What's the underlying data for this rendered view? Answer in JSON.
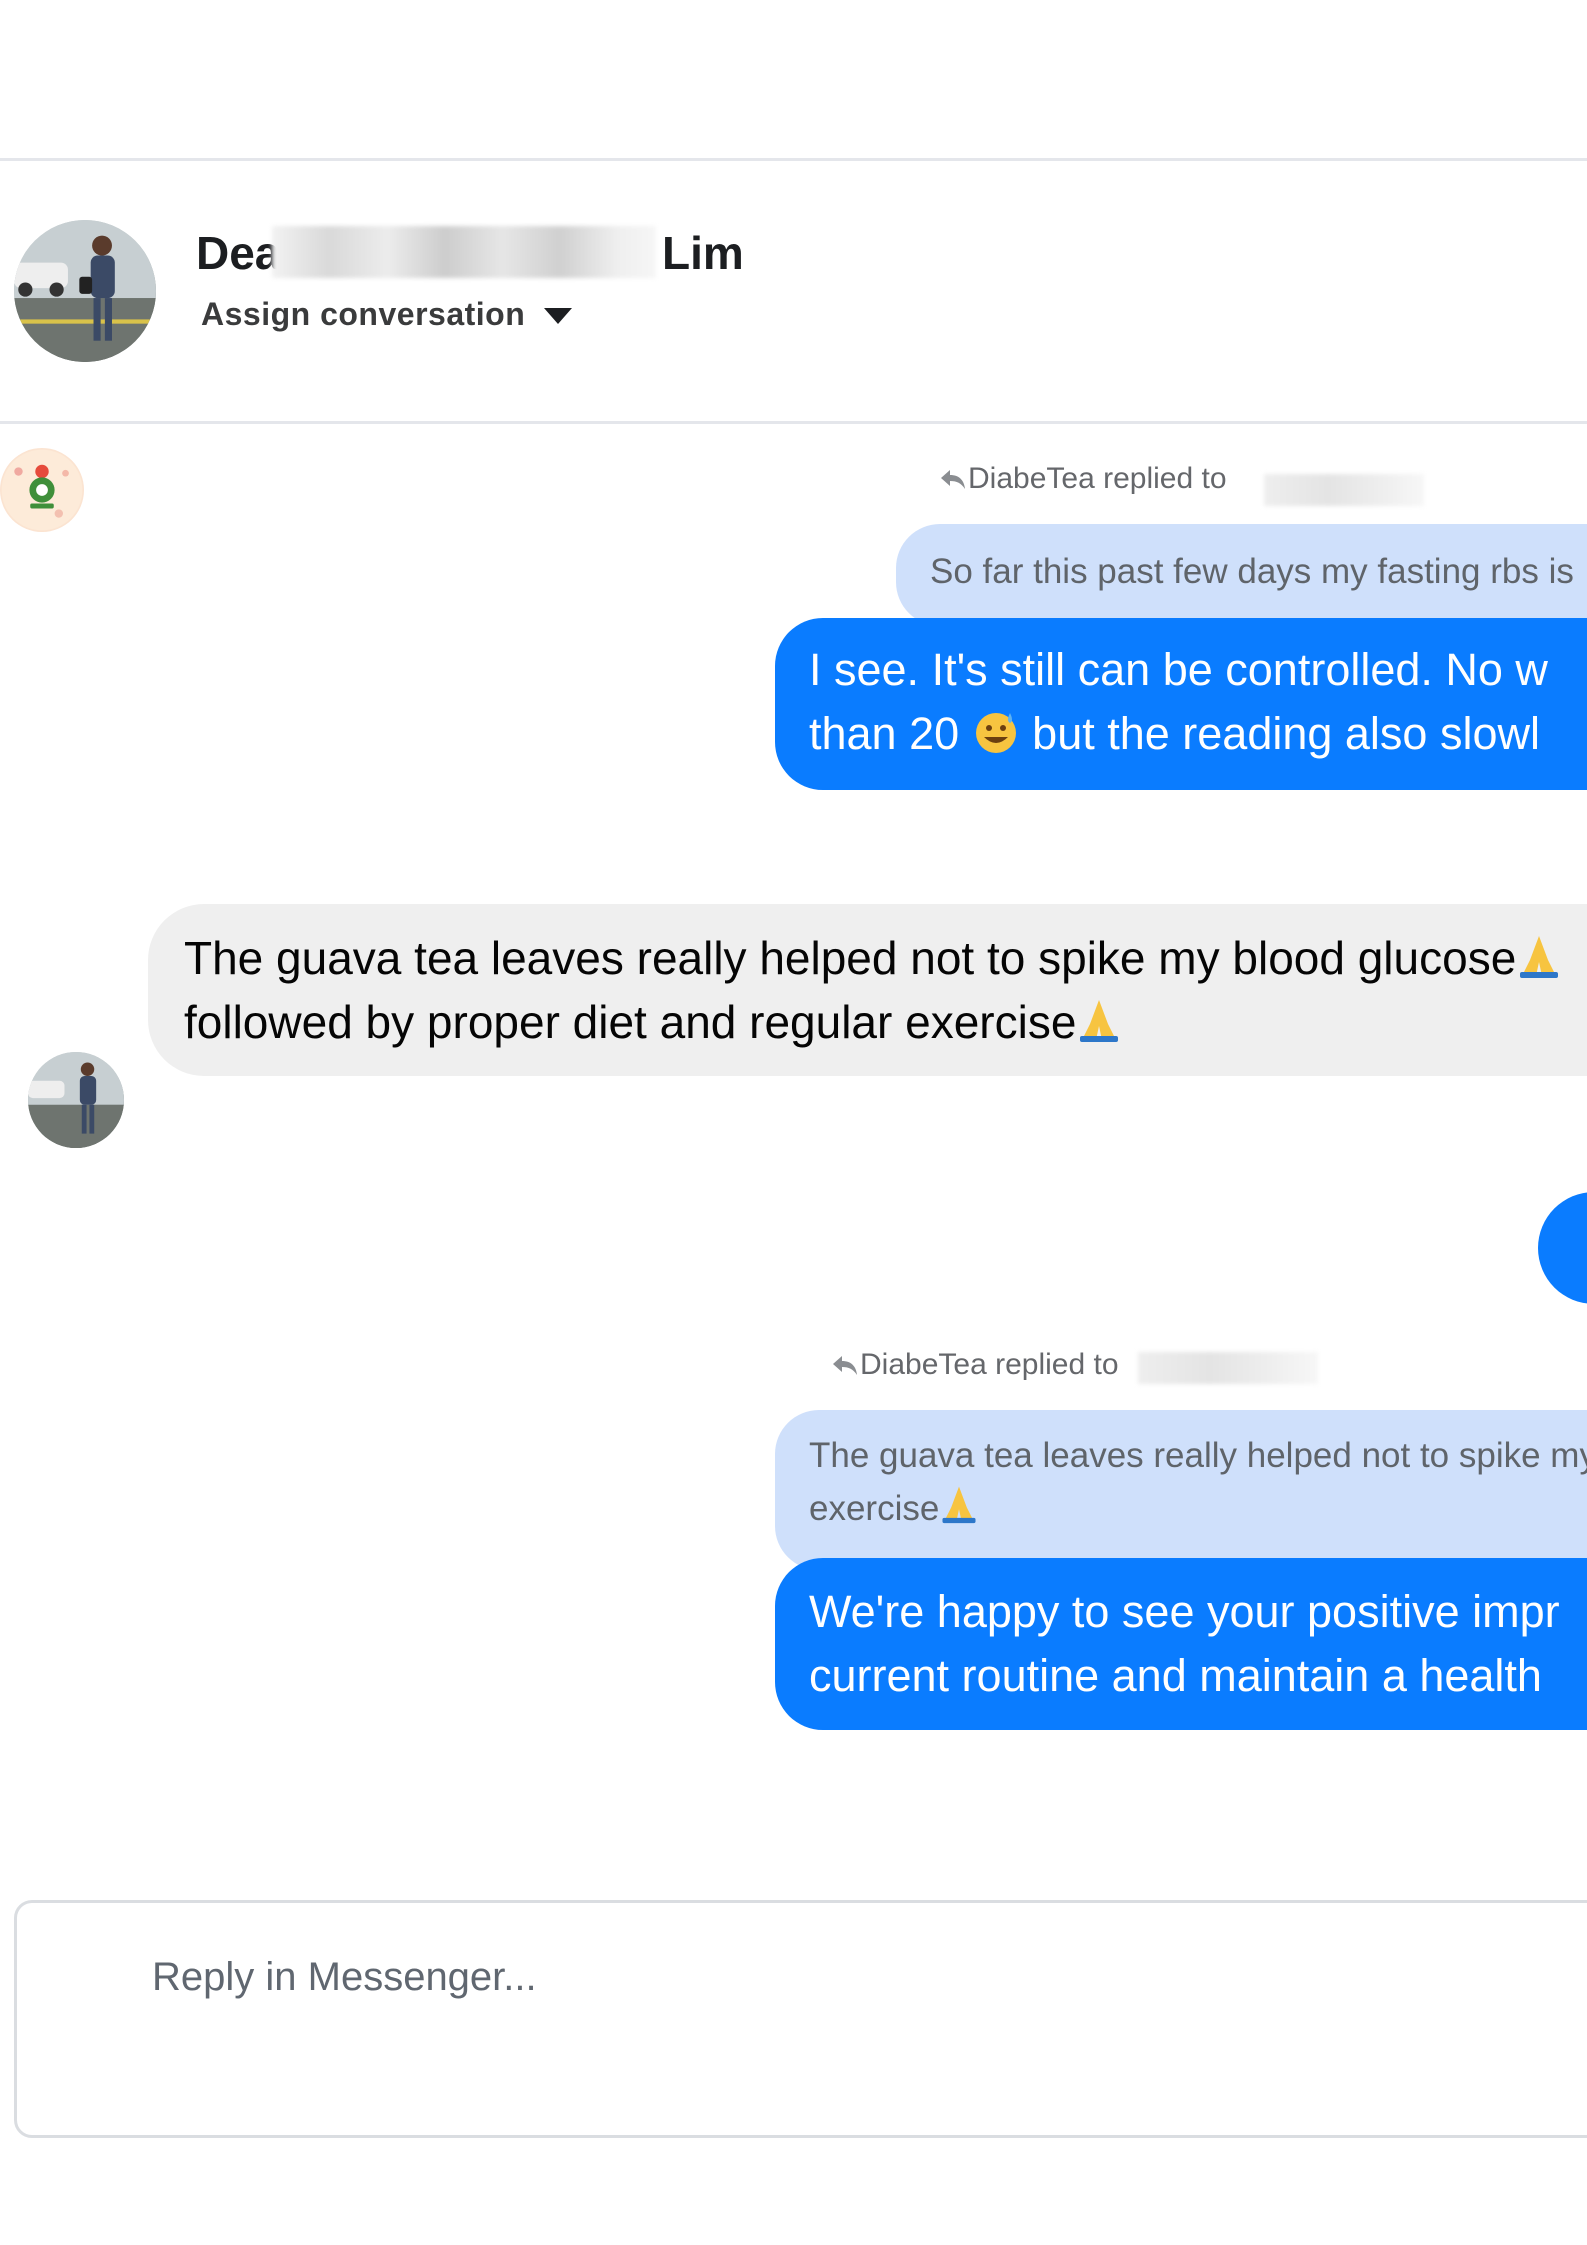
{
  "header": {
    "contact_name_start": "Dea",
    "contact_name_end": "Lim",
    "assign_label": "Assign conversation"
  },
  "messages": {
    "reply1": {
      "replied_label": "DiabeTea replied to",
      "quote": "So far this past few days my fasting rbs is",
      "text_line1": "I see. It's still can be controlled. No w",
      "text_line2_a": "than 20",
      "text_line2_b": "but the reading also slowl"
    },
    "incoming": {
      "line1": "The guava tea leaves really helped not to spike my blood glucose",
      "line2": "followed by proper diet and regular exercise"
    },
    "reply2": {
      "replied_label": "DiabeTea replied to",
      "quote_line1": "The guava tea leaves really helped not to spike my",
      "quote_line2": "exercise",
      "text_line1": "We're happy to see your positive impr",
      "text_line2": "current routine and maintain a health"
    }
  },
  "composer": {
    "placeholder": "Reply in Messenger..."
  },
  "colors": {
    "accent_blue": "#0a7cff",
    "quote_blue": "#cfe0fb",
    "incoming_grey": "#efefef"
  }
}
